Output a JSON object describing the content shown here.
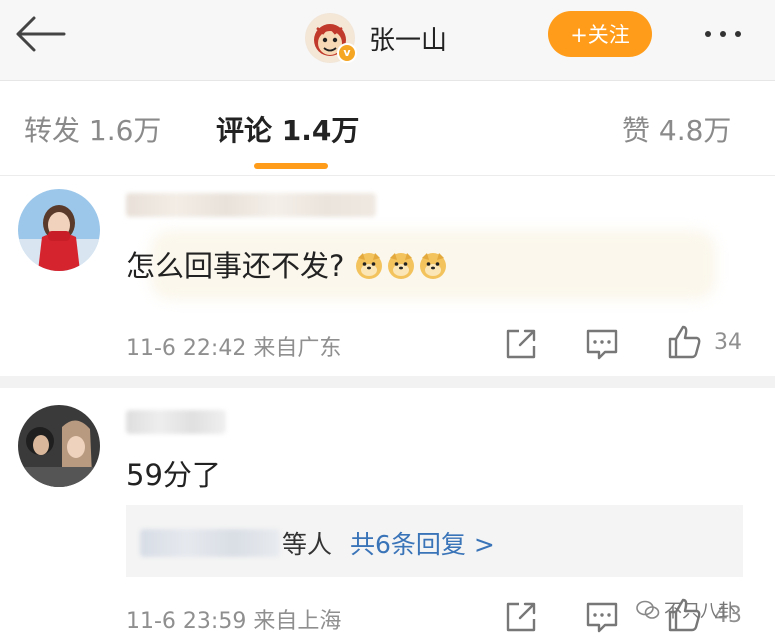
{
  "header": {
    "account_name": "张一山",
    "follow_label": "+关注"
  },
  "tabs": [
    {
      "label": "转发 1.6万"
    },
    {
      "label": "评论 1.4万"
    },
    {
      "label": "赞 4.8万"
    }
  ],
  "comments": [
    {
      "text": "怎么回事还不发?",
      "emoji": [
        "doge",
        "doge",
        "doge"
      ],
      "time_location": "11-6 22:42 来自广东",
      "likes": "34"
    },
    {
      "text": "59分了",
      "reply_summary_who": "等人",
      "reply_summary_link": "共6条回复 >",
      "time_location": "11-6 23:59 来自上海",
      "likes": "43"
    }
  ],
  "watermark": "不只八卦",
  "colors": {
    "accent": "#ff9c1a",
    "link": "#3a74b8",
    "secondary_text": "#8f8f8f"
  },
  "icons": [
    "back-arrow-icon",
    "verified-icon",
    "more-icon",
    "share-icon",
    "comment-icon",
    "like-icon",
    "wechat-icon"
  ]
}
